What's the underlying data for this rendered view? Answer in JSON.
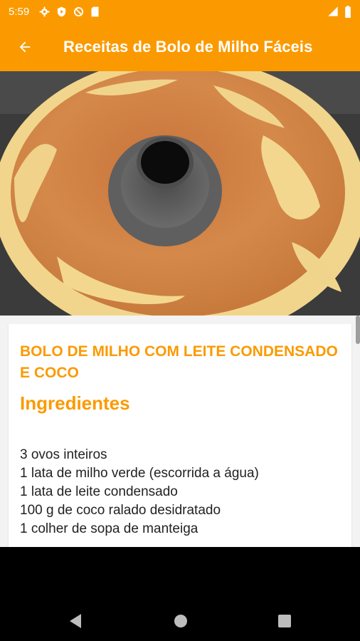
{
  "status_bar": {
    "time": "5:59",
    "icons": [
      "gear-icon",
      "play-protect-icon",
      "no-entry-icon",
      "sim-card-icon"
    ],
    "right_icons": [
      "signal-icon",
      "battery-icon"
    ]
  },
  "app_bar": {
    "title": "Receitas de Bolo de Milho Fáceis",
    "back_icon": "arrow-back-icon"
  },
  "hero_image": {
    "subject": "bundt-cake",
    "colors": {
      "crust": "#c97a3a",
      "crumb": "#f3d58a",
      "pan": "#5f5f5f",
      "bg": "#3a3a3a"
    }
  },
  "recipe": {
    "title": "BOLO DE MILHO COM LEITE CONDENSADO E COCO",
    "section_heading": "Ingredientes",
    "ingredients": [
      "3 ovos inteiros",
      "1 lata de milho verde (escorrida a água)",
      "1 lata de leite condensado",
      "100 g de coco ralado desidratado",
      "1 colher de sopa de manteiga"
    ]
  },
  "navigation": {
    "buttons": [
      "back-triangle-icon",
      "home-circle-icon",
      "recents-square-icon"
    ]
  },
  "colors": {
    "accent": "#fb9a00",
    "text": "#222222",
    "nav_bg": "#000000"
  }
}
